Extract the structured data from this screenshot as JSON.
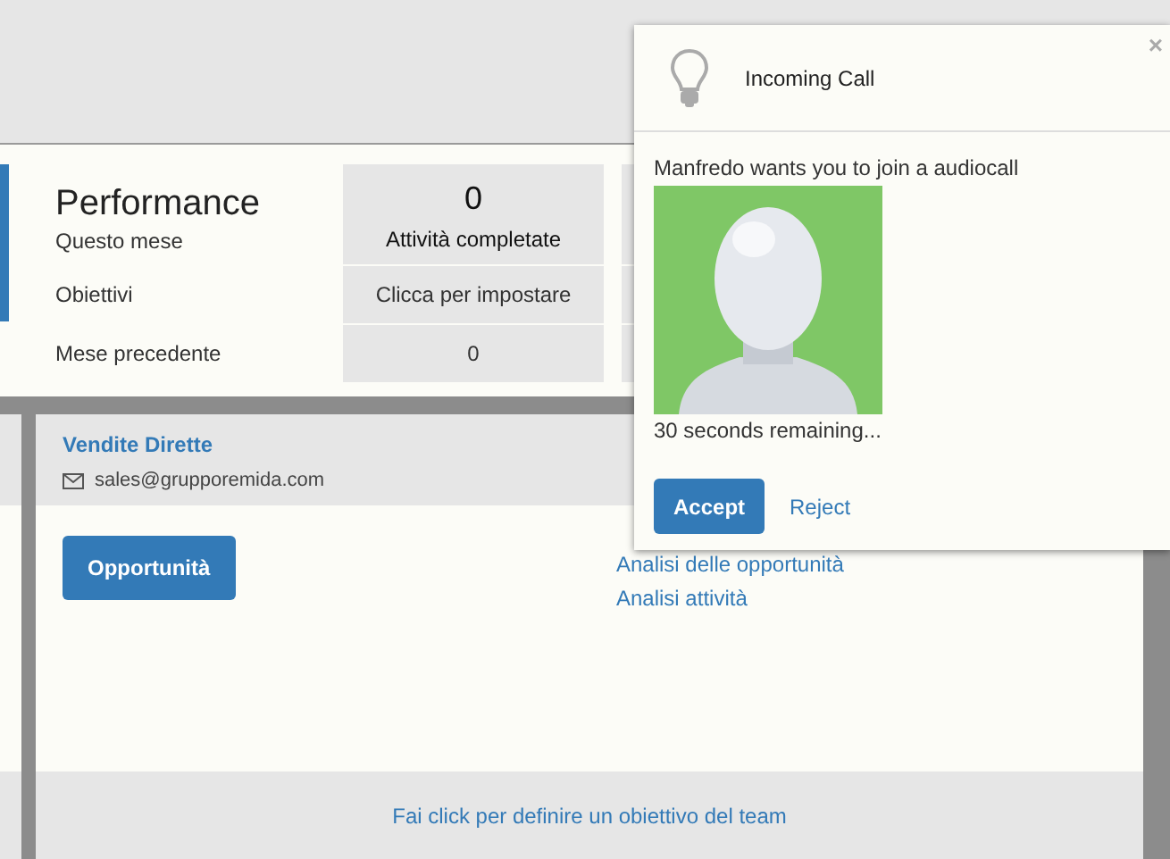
{
  "performance": {
    "title": "Performance",
    "period_label": "Questo mese",
    "kpi": {
      "value": "0",
      "caption": "Attività completate"
    },
    "rows": [
      {
        "label": "Obiettivi",
        "value": "Clicca per impostare"
      },
      {
        "label": "Mese precedente",
        "value": "0"
      }
    ]
  },
  "team_card": {
    "name": "Vendite Dirette",
    "email": "sales@grupporemida.com",
    "button": "Opportunità",
    "links": [
      "Analisi delle opportunità",
      "Analisi attività"
    ],
    "footer_link": "Fai click per definire un obiettivo del team"
  },
  "call_popup": {
    "title": "Incoming Call",
    "close": "×",
    "message": "Manfredo wants you to join a audiocall",
    "countdown": "30 seconds remaining...",
    "buttons": [
      {
        "label": "Accept",
        "kind": "primary"
      },
      {
        "label": "Reject",
        "kind": "link"
      }
    ]
  }
}
